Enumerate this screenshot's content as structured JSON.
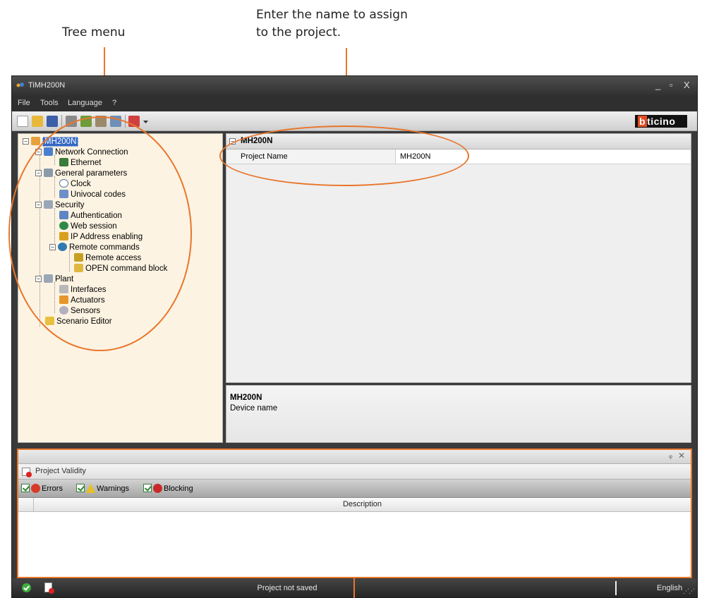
{
  "annotations": {
    "tree_menu": "Tree menu",
    "project_name_line1": "Enter the name to assign",
    "project_name_line2": "to the project."
  },
  "window": {
    "title": "TiMH200N",
    "minimize": "_",
    "maximize": "▫",
    "close": "X"
  },
  "menu": [
    "File",
    "Tools",
    "Language",
    "?"
  ],
  "logo": {
    "highlight": "b",
    "text": "ticino"
  },
  "tree": {
    "root": "MH200N",
    "network_connection": "Network Connection",
    "ethernet": "Ethernet",
    "general_parameters": "General parameters",
    "clock": "Clock",
    "univocal_codes": "Univocal codes",
    "security": "Security",
    "authentication": "Authentication",
    "web_session": "Web session",
    "ip_address_enabling": "IP Address enabling",
    "remote_commands": "Remote commands",
    "remote_access": "Remote access",
    "open_command_block": "OPEN command block",
    "plant": "Plant",
    "interfaces": "Interfaces",
    "actuators": "Actuators",
    "sensors": "Sensors",
    "scenario_editor": "Scenario Editor"
  },
  "properties": {
    "category": "MH200N",
    "rows": [
      {
        "name": "Project Name",
        "value": "MH200N"
      }
    ]
  },
  "description": {
    "title": "MH200N",
    "text": "Device name"
  },
  "bottom_panel": {
    "pin": "ᵩ",
    "close": "✕",
    "tab_label": "Project Validity",
    "filters": {
      "errors": "Errors",
      "warnings": "Warnings",
      "blocking": "Blocking"
    },
    "column_description": "Description"
  },
  "status_bar": {
    "status": "Project not saved",
    "language": "English"
  },
  "colors": {
    "callout": "#e8762b",
    "tree_bg": "#fdf3e2",
    "selection": "#3468c4"
  }
}
